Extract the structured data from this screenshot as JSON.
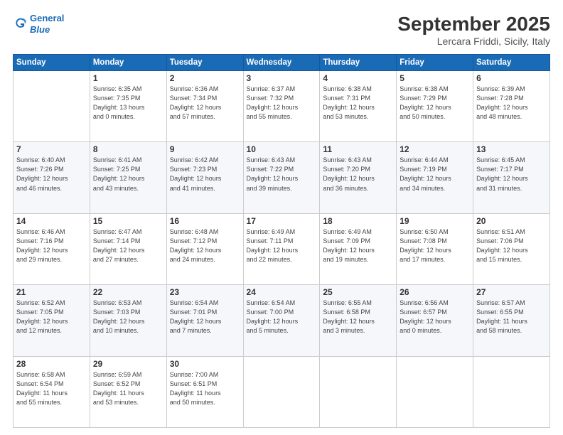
{
  "header": {
    "logo_line1": "General",
    "logo_line2": "Blue",
    "title": "September 2025",
    "subtitle": "Lercara Friddi, Sicily, Italy"
  },
  "columns": [
    "Sunday",
    "Monday",
    "Tuesday",
    "Wednesday",
    "Thursday",
    "Friday",
    "Saturday"
  ],
  "rows": [
    [
      {
        "day": "",
        "info": ""
      },
      {
        "day": "1",
        "info": "Sunrise: 6:35 AM\nSunset: 7:35 PM\nDaylight: 13 hours\nand 0 minutes."
      },
      {
        "day": "2",
        "info": "Sunrise: 6:36 AM\nSunset: 7:34 PM\nDaylight: 12 hours\nand 57 minutes."
      },
      {
        "day": "3",
        "info": "Sunrise: 6:37 AM\nSunset: 7:32 PM\nDaylight: 12 hours\nand 55 minutes."
      },
      {
        "day": "4",
        "info": "Sunrise: 6:38 AM\nSunset: 7:31 PM\nDaylight: 12 hours\nand 53 minutes."
      },
      {
        "day": "5",
        "info": "Sunrise: 6:38 AM\nSunset: 7:29 PM\nDaylight: 12 hours\nand 50 minutes."
      },
      {
        "day": "6",
        "info": "Sunrise: 6:39 AM\nSunset: 7:28 PM\nDaylight: 12 hours\nand 48 minutes."
      }
    ],
    [
      {
        "day": "7",
        "info": "Sunrise: 6:40 AM\nSunset: 7:26 PM\nDaylight: 12 hours\nand 46 minutes."
      },
      {
        "day": "8",
        "info": "Sunrise: 6:41 AM\nSunset: 7:25 PM\nDaylight: 12 hours\nand 43 minutes."
      },
      {
        "day": "9",
        "info": "Sunrise: 6:42 AM\nSunset: 7:23 PM\nDaylight: 12 hours\nand 41 minutes."
      },
      {
        "day": "10",
        "info": "Sunrise: 6:43 AM\nSunset: 7:22 PM\nDaylight: 12 hours\nand 39 minutes."
      },
      {
        "day": "11",
        "info": "Sunrise: 6:43 AM\nSunset: 7:20 PM\nDaylight: 12 hours\nand 36 minutes."
      },
      {
        "day": "12",
        "info": "Sunrise: 6:44 AM\nSunset: 7:19 PM\nDaylight: 12 hours\nand 34 minutes."
      },
      {
        "day": "13",
        "info": "Sunrise: 6:45 AM\nSunset: 7:17 PM\nDaylight: 12 hours\nand 31 minutes."
      }
    ],
    [
      {
        "day": "14",
        "info": "Sunrise: 6:46 AM\nSunset: 7:16 PM\nDaylight: 12 hours\nand 29 minutes."
      },
      {
        "day": "15",
        "info": "Sunrise: 6:47 AM\nSunset: 7:14 PM\nDaylight: 12 hours\nand 27 minutes."
      },
      {
        "day": "16",
        "info": "Sunrise: 6:48 AM\nSunset: 7:12 PM\nDaylight: 12 hours\nand 24 minutes."
      },
      {
        "day": "17",
        "info": "Sunrise: 6:49 AM\nSunset: 7:11 PM\nDaylight: 12 hours\nand 22 minutes."
      },
      {
        "day": "18",
        "info": "Sunrise: 6:49 AM\nSunset: 7:09 PM\nDaylight: 12 hours\nand 19 minutes."
      },
      {
        "day": "19",
        "info": "Sunrise: 6:50 AM\nSunset: 7:08 PM\nDaylight: 12 hours\nand 17 minutes."
      },
      {
        "day": "20",
        "info": "Sunrise: 6:51 AM\nSunset: 7:06 PM\nDaylight: 12 hours\nand 15 minutes."
      }
    ],
    [
      {
        "day": "21",
        "info": "Sunrise: 6:52 AM\nSunset: 7:05 PM\nDaylight: 12 hours\nand 12 minutes."
      },
      {
        "day": "22",
        "info": "Sunrise: 6:53 AM\nSunset: 7:03 PM\nDaylight: 12 hours\nand 10 minutes."
      },
      {
        "day": "23",
        "info": "Sunrise: 6:54 AM\nSunset: 7:01 PM\nDaylight: 12 hours\nand 7 minutes."
      },
      {
        "day": "24",
        "info": "Sunrise: 6:54 AM\nSunset: 7:00 PM\nDaylight: 12 hours\nand 5 minutes."
      },
      {
        "day": "25",
        "info": "Sunrise: 6:55 AM\nSunset: 6:58 PM\nDaylight: 12 hours\nand 3 minutes."
      },
      {
        "day": "26",
        "info": "Sunrise: 6:56 AM\nSunset: 6:57 PM\nDaylight: 12 hours\nand 0 minutes."
      },
      {
        "day": "27",
        "info": "Sunrise: 6:57 AM\nSunset: 6:55 PM\nDaylight: 11 hours\nand 58 minutes."
      }
    ],
    [
      {
        "day": "28",
        "info": "Sunrise: 6:58 AM\nSunset: 6:54 PM\nDaylight: 11 hours\nand 55 minutes."
      },
      {
        "day": "29",
        "info": "Sunrise: 6:59 AM\nSunset: 6:52 PM\nDaylight: 11 hours\nand 53 minutes."
      },
      {
        "day": "30",
        "info": "Sunrise: 7:00 AM\nSunset: 6:51 PM\nDaylight: 11 hours\nand 50 minutes."
      },
      {
        "day": "",
        "info": ""
      },
      {
        "day": "",
        "info": ""
      },
      {
        "day": "",
        "info": ""
      },
      {
        "day": "",
        "info": ""
      }
    ]
  ]
}
